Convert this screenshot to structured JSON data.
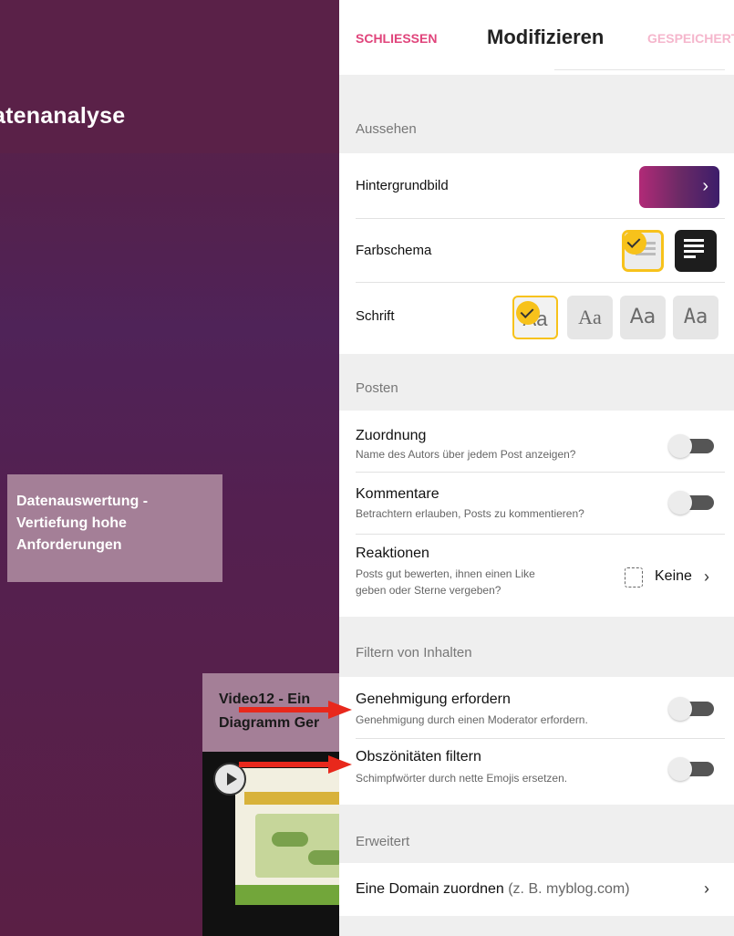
{
  "board": {
    "title": "atenanalyse",
    "card1": {
      "lines": [
        "Datenauswertung -",
        "Vertiefung hohe",
        "Anforderungen"
      ]
    },
    "card2": {
      "lines": [
        "Video12 -  Ein",
        "Diagramm Ger"
      ]
    }
  },
  "panel": {
    "close_label": "SCHLIESSEN",
    "title": "Modifizieren",
    "save_label": "GESPEICHERT",
    "sections": {
      "appearance": "Aussehen",
      "posting": "Posten",
      "content_filter": "Filtern von Inhalten",
      "advanced": "Erweitert"
    },
    "appearance": {
      "wallpaper_label": "Hintergrundbild",
      "color_scheme_label": "Farbschema",
      "font_label": "Schrift",
      "font_sample": "Aa",
      "selected_font": "first"
    },
    "posting": {
      "attribution": {
        "title": "Zuordnung",
        "desc": "Name des Autors über jedem Post anzeigen?",
        "enabled": false
      },
      "comments": {
        "title": "Kommentare",
        "desc": "Betrachtern erlauben, Posts zu kommentieren?",
        "enabled": false
      },
      "reactions": {
        "title": "Reaktionen",
        "desc_line1": "Posts gut bewerten, ihnen einen Like",
        "desc_line2": "geben oder Sterne vergeben?",
        "value": "Keine"
      }
    },
    "content_filter": {
      "approval": {
        "title": "Genehmigung erfordern",
        "desc": "Genehmigung durch einen Moderator erfordern.",
        "enabled": false
      },
      "profanity": {
        "title": "Obszönitäten filtern",
        "desc": "Schimpfwörter durch nette Emojis ersetzen.",
        "enabled": false
      }
    },
    "advanced": {
      "domain_title": "Eine Domain zuordnen",
      "domain_hint": "(z. B. myblog.com)"
    }
  },
  "colors": {
    "accent_pink": "#e0447b",
    "selected_yellow": "#f7c21b",
    "annotation_arrow": "#e8281c"
  }
}
